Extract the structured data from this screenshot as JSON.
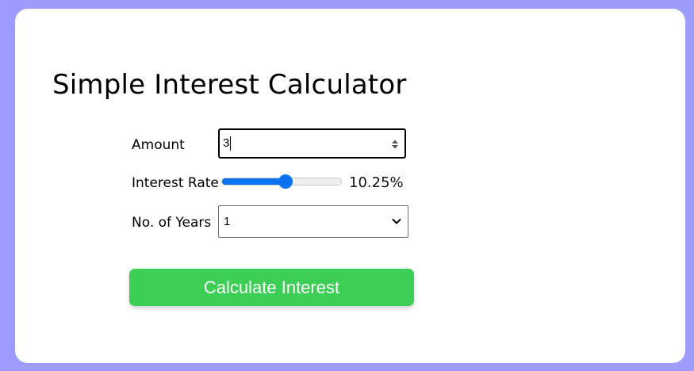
{
  "app": {
    "title": "Simple Interest Calculator"
  },
  "form": {
    "amount": {
      "label": "Amount",
      "value": "3"
    },
    "rate": {
      "label": "Interest Rate",
      "value_text": "10.25%",
      "slider_fraction": 0.5
    },
    "years": {
      "label": "No. of Years",
      "selected": "1"
    },
    "submit_label": "Calculate Interest"
  },
  "colors": {
    "page_background": "#9d9cfa",
    "card_background": "#ffffff",
    "slider_accent": "#0a74f0",
    "button_background": "#3dce55",
    "button_text": "#ffffff"
  },
  "icons": {
    "amount_spinner": "spinner-arrows-icon",
    "years_dropdown": "chevron-down-icon"
  }
}
